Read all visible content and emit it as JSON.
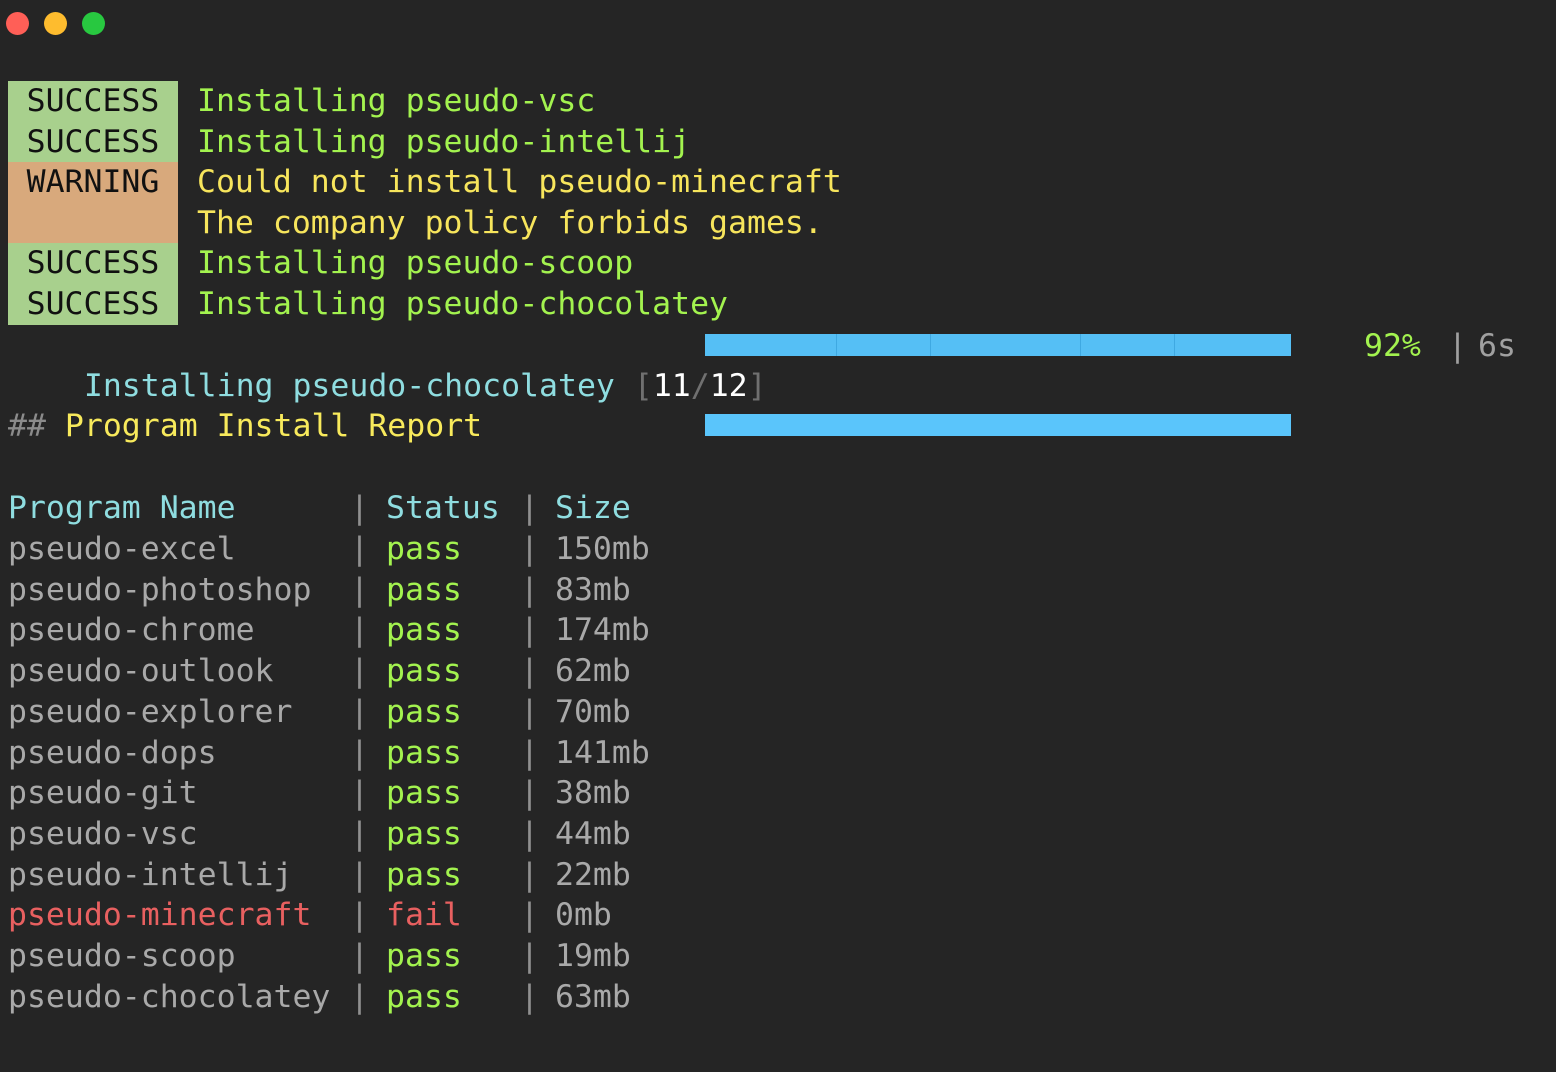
{
  "window": {
    "controls": [
      "close",
      "minimize",
      "zoom"
    ]
  },
  "log": [
    {
      "badge": "SUCCESS",
      "level": "success",
      "message": "Installing pseudo-vsc"
    },
    {
      "badge": "SUCCESS",
      "level": "success",
      "message": "Installing pseudo-intellij"
    },
    {
      "badge": "WARNING",
      "level": "warning",
      "message": "Could not install pseudo-minecraft"
    },
    {
      "badge": "",
      "level": "warning",
      "message": "The company policy forbids games."
    },
    {
      "badge": "SUCCESS",
      "level": "success",
      "message": "Installing pseudo-scoop"
    },
    {
      "badge": "SUCCESS",
      "level": "success",
      "message": "Installing pseudo-chocolatey"
    }
  ],
  "progress": {
    "label": "Installing pseudo-chocolatey",
    "bracket_open": "[",
    "current": "11",
    "slash": "/",
    "total": "12",
    "bracket_close": "]",
    "fraction": 1.0,
    "percent_text": "92%",
    "separator": "|",
    "elapsed": "6s",
    "bar_color": "#5ac5fb"
  },
  "report": {
    "hash": "##",
    "title": "Program Install Report",
    "separator": "|",
    "columns": [
      "Program Name",
      "Status",
      "Size"
    ],
    "rows": [
      {
        "name": "pseudo-excel",
        "status": "pass",
        "size": "150mb"
      },
      {
        "name": "pseudo-photoshop",
        "status": "pass",
        "size": "83mb"
      },
      {
        "name": "pseudo-chrome",
        "status": "pass",
        "size": "174mb"
      },
      {
        "name": "pseudo-outlook",
        "status": "pass",
        "size": "62mb"
      },
      {
        "name": "pseudo-explorer",
        "status": "pass",
        "size": "70mb"
      },
      {
        "name": "pseudo-dops",
        "status": "pass",
        "size": "141mb"
      },
      {
        "name": "pseudo-git",
        "status": "pass",
        "size": "38mb"
      },
      {
        "name": "pseudo-vsc",
        "status": "pass",
        "size": "44mb"
      },
      {
        "name": "pseudo-intellij",
        "status": "pass",
        "size": "22mb"
      },
      {
        "name": "pseudo-minecraft",
        "status": "fail",
        "size": "0mb"
      },
      {
        "name": "pseudo-scoop",
        "status": "pass",
        "size": "19mb"
      },
      {
        "name": "pseudo-chocolatey",
        "status": "pass",
        "size": "63mb"
      }
    ]
  },
  "colors": {
    "background": "#252525",
    "success_badge": "#a8d08d",
    "warning_badge": "#d8a97c",
    "success_text": "#a3f34f",
    "warning_text": "#f7e55c",
    "fail_text": "#e86060",
    "header_text": "#8fdde0"
  }
}
